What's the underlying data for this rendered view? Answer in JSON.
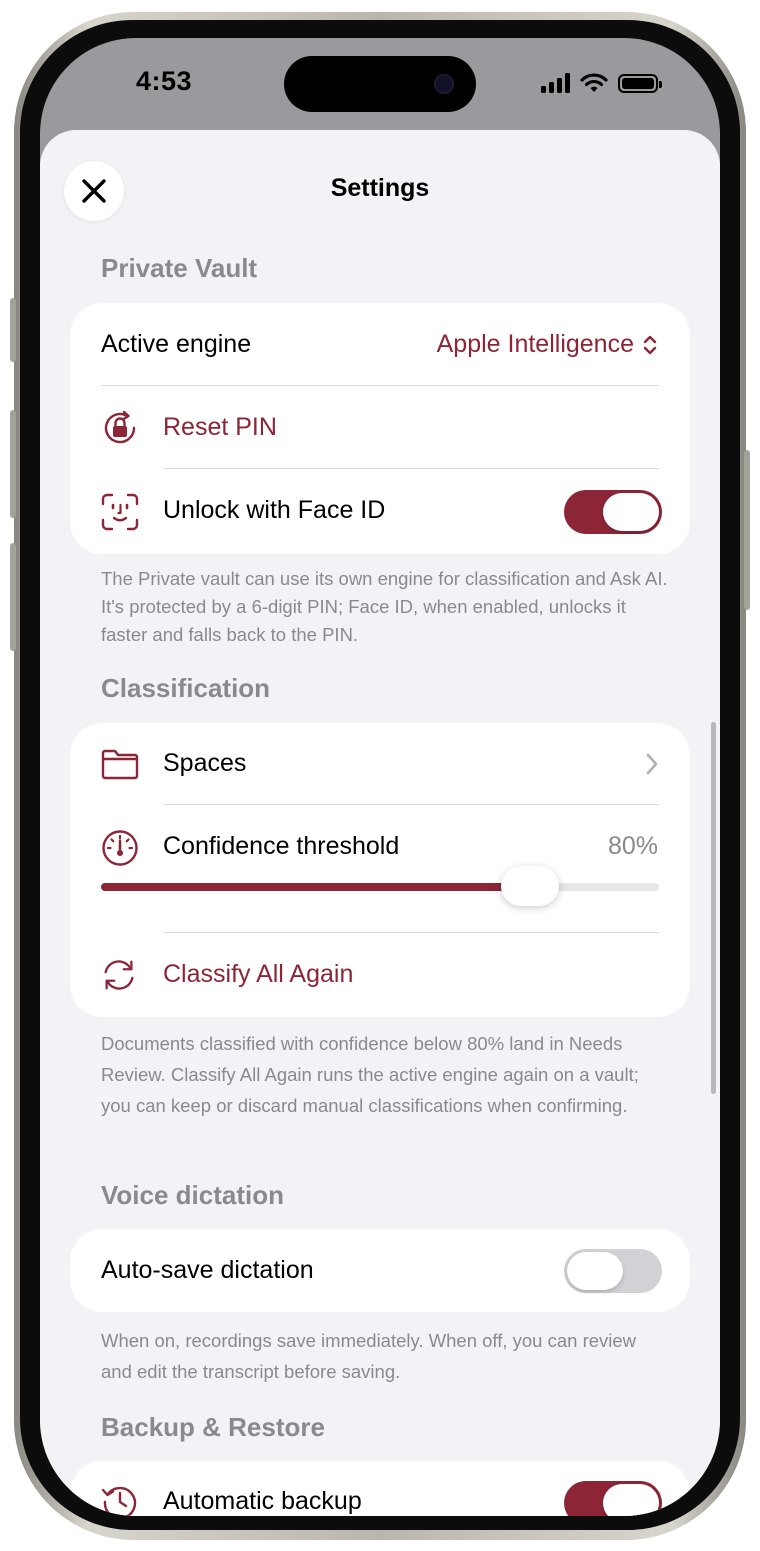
{
  "status_bar": {
    "time": "4:53"
  },
  "header": {
    "title": "Settings"
  },
  "private_vault": {
    "header": "Private Vault",
    "active_engine_label": "Active engine",
    "active_engine_value": "Apple Intelligence",
    "reset_pin_label": "Reset PIN",
    "face_id_label": "Unlock with Face ID",
    "face_id_enabled": true,
    "footnote": "The Private vault can use its own engine for classification and Ask AI. It's protected by a 6-digit PIN; Face ID, when enabled, unlocks it faster and falls back to the PIN."
  },
  "classification": {
    "header": "Classification",
    "spaces_label": "Spaces",
    "confidence_label": "Confidence threshold",
    "confidence_value_text": "80%",
    "confidence_fraction": 0.8,
    "classify_all_label": "Classify All Again",
    "footnote": "Documents classified with confidence below 80% land in Needs Review. Classify All Again runs the active engine again on a vault; you can keep or discard manual classifications when confirming."
  },
  "voice_dictation": {
    "header": "Voice dictation",
    "auto_save_label": "Auto-save dictation",
    "auto_save_enabled": false,
    "footnote": "When on, recordings save immediately. When off, you can review and edit the transcript before saving."
  },
  "backup_restore": {
    "header": "Backup & Restore",
    "automatic_backup_label": "Automatic backup",
    "automatic_backup_enabled": true
  },
  "colors": {
    "accent": "#8c2536",
    "background": "#f2f2f7",
    "secondary_text": "#8a8a8e"
  }
}
